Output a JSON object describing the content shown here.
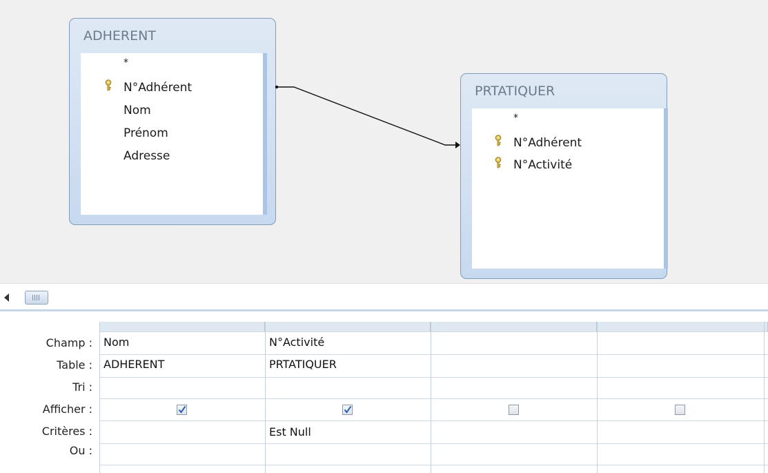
{
  "tables": [
    {
      "name": "ADHERENT",
      "fields": [
        {
          "label": "*",
          "key": false
        },
        {
          "label": "N°Adhérent",
          "key": true
        },
        {
          "label": "Nom",
          "key": false
        },
        {
          "label": "Prénom",
          "key": false
        },
        {
          "label": "Adresse",
          "key": false
        }
      ]
    },
    {
      "name": "PRTATIQUER",
      "fields": [
        {
          "label": "*",
          "key": false
        },
        {
          "label": "N°Adhérent",
          "key": true
        },
        {
          "label": "N°Activité",
          "key": true
        }
      ]
    }
  ],
  "grid": {
    "row_labels": [
      "Champ :",
      "Table :",
      "Tri :",
      "Afficher :",
      "Critères :",
      "Ou :"
    ],
    "columns": [
      {
        "champ": "Nom",
        "table": "ADHERENT",
        "tri": "",
        "afficher": true,
        "criteres": "",
        "ou": ""
      },
      {
        "champ": "N°Activité",
        "table": "PRTATIQUER",
        "tri": "",
        "afficher": true,
        "criteres": "Est Null",
        "ou": ""
      },
      {
        "champ": "",
        "table": "",
        "tri": "",
        "afficher": false,
        "criteres": "",
        "ou": ""
      },
      {
        "champ": "",
        "table": "",
        "tri": "",
        "afficher": false,
        "criteres": "",
        "ou": ""
      }
    ]
  },
  "colors": {
    "table_title": "#6c7a89",
    "table_border": "#7f9db9",
    "checkmark": "#2a5fb0"
  }
}
